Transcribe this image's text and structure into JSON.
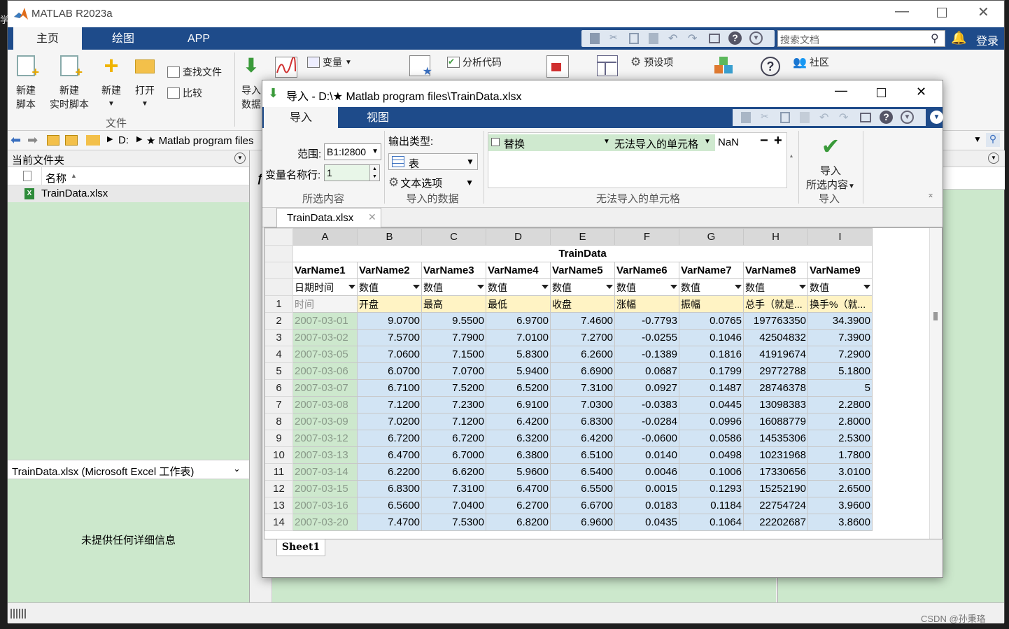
{
  "app": {
    "title": "MATLAB R2023a",
    "tabs": [
      "主页",
      "绘图",
      "APP"
    ],
    "search_placeholder": "搜索文档",
    "login": "登录"
  },
  "ribbon": {
    "new_script": [
      "新建",
      "脚本"
    ],
    "new_live_script": [
      "新建",
      "实时脚本"
    ],
    "new": "新建",
    "open": "打开",
    "find_files": "查找文件",
    "compare": "比较",
    "group_file": "文件",
    "import_data": [
      "导入",
      "数据"
    ],
    "variable": "变量",
    "analyze_code": "分析代码",
    "preferences": "预设项",
    "community": "社区"
  },
  "path": {
    "drive": "D:",
    "folder": "★ Matlab program files"
  },
  "left_panel": {
    "header": "当前文件夹",
    "col_name": "名称",
    "file": "TrainData.xlsx",
    "details_title": "TrainData.xlsx  (Microsoft Excel 工作表)",
    "details_empty": "未提供任何详细信息"
  },
  "dialog": {
    "title": "导入 - D:\\★ Matlab program files\\TrainData.xlsx",
    "tabs": [
      "导入",
      "视图"
    ],
    "range_label": "范围:",
    "range_value": "B1:I2800",
    "varname_row_label": "变量名称行:",
    "varname_row_value": "1",
    "group_selection": "所选内容",
    "output_type_label": "输出类型:",
    "output_type_value": "表",
    "text_options": "文本选项",
    "group_imported": "导入的数据",
    "replace_label": "替换",
    "unimportable_label": "无法导入的单元格",
    "replace_value": "NaN",
    "group_unimportable": "无法导入的单元格",
    "import_button": [
      "导入",
      "所选内容"
    ],
    "group_import": "导入",
    "file_tab": "TrainData.xlsx",
    "sheet_tab": "Sheet1"
  },
  "grid": {
    "columns": [
      "A",
      "B",
      "C",
      "D",
      "E",
      "F",
      "G",
      "H",
      "I"
    ],
    "table_name": "TrainData",
    "var_names": [
      "VarName1",
      "VarName2",
      "VarName3",
      "VarName4",
      "VarName5",
      "VarName6",
      "VarName7",
      "VarName8",
      "VarName9"
    ],
    "var_types": [
      "日期时间",
      "数值",
      "数值",
      "数值",
      "数值",
      "数值",
      "数值",
      "数值",
      "数值"
    ],
    "header_row": [
      "时间",
      "开盘",
      "最高",
      "最低",
      "收盘",
      "涨幅",
      "振幅",
      "总手（就是...",
      "换手%（就..."
    ],
    "rows": [
      [
        "2007-03-01",
        "9.0700",
        "9.5500",
        "6.9700",
        "7.4600",
        "-0.7793",
        "0.0765",
        "197763350",
        "34.3900"
      ],
      [
        "2007-03-02",
        "7.5700",
        "7.7900",
        "7.0100",
        "7.2700",
        "-0.0255",
        "0.1046",
        "42504832",
        "7.3900"
      ],
      [
        "2007-03-05",
        "7.0600",
        "7.1500",
        "5.8300",
        "6.2600",
        "-0.1389",
        "0.1816",
        "41919674",
        "7.2900"
      ],
      [
        "2007-03-06",
        "6.0700",
        "7.0700",
        "5.9400",
        "6.6900",
        "0.0687",
        "0.1799",
        "29772788",
        "5.1800"
      ],
      [
        "2007-03-07",
        "6.7100",
        "7.5200",
        "6.5200",
        "7.3100",
        "0.0927",
        "0.1487",
        "28746378",
        "5"
      ],
      [
        "2007-03-08",
        "7.1200",
        "7.2300",
        "6.9100",
        "7.0300",
        "-0.0383",
        "0.0445",
        "13098383",
        "2.2800"
      ],
      [
        "2007-03-09",
        "7.0200",
        "7.1200",
        "6.4200",
        "6.8300",
        "-0.0284",
        "0.0996",
        "16088779",
        "2.8000"
      ],
      [
        "2007-03-12",
        "6.7200",
        "6.7200",
        "6.3200",
        "6.4200",
        "-0.0600",
        "0.0586",
        "14535306",
        "2.5300"
      ],
      [
        "2007-03-13",
        "6.4700",
        "6.7000",
        "6.3800",
        "6.5100",
        "0.0140",
        "0.0498",
        "10231968",
        "1.7800"
      ],
      [
        "2007-03-14",
        "6.2200",
        "6.6200",
        "5.9600",
        "6.5400",
        "0.0046",
        "0.1006",
        "17330656",
        "3.0100"
      ],
      [
        "2007-03-15",
        "6.8300",
        "7.3100",
        "6.4700",
        "6.5500",
        "0.0015",
        "0.1293",
        "15252190",
        "2.6500"
      ],
      [
        "2007-03-16",
        "6.5600",
        "7.0400",
        "6.2700",
        "6.6700",
        "0.0183",
        "0.1184",
        "22754724",
        "3.9600"
      ],
      [
        "2007-03-20",
        "7.4700",
        "7.5300",
        "6.8200",
        "6.9600",
        "0.0435",
        "0.1064",
        "22202687",
        "3.8600"
      ]
    ]
  },
  "watermark": "CSDN @孙秉珞",
  "colors": {
    "tabbar": "#1e4b8a",
    "selected_data": "#d2e4f4",
    "header_row": "#fff3c4",
    "date_col": "#cde8cd",
    "panel_green": "#cce8cc"
  }
}
